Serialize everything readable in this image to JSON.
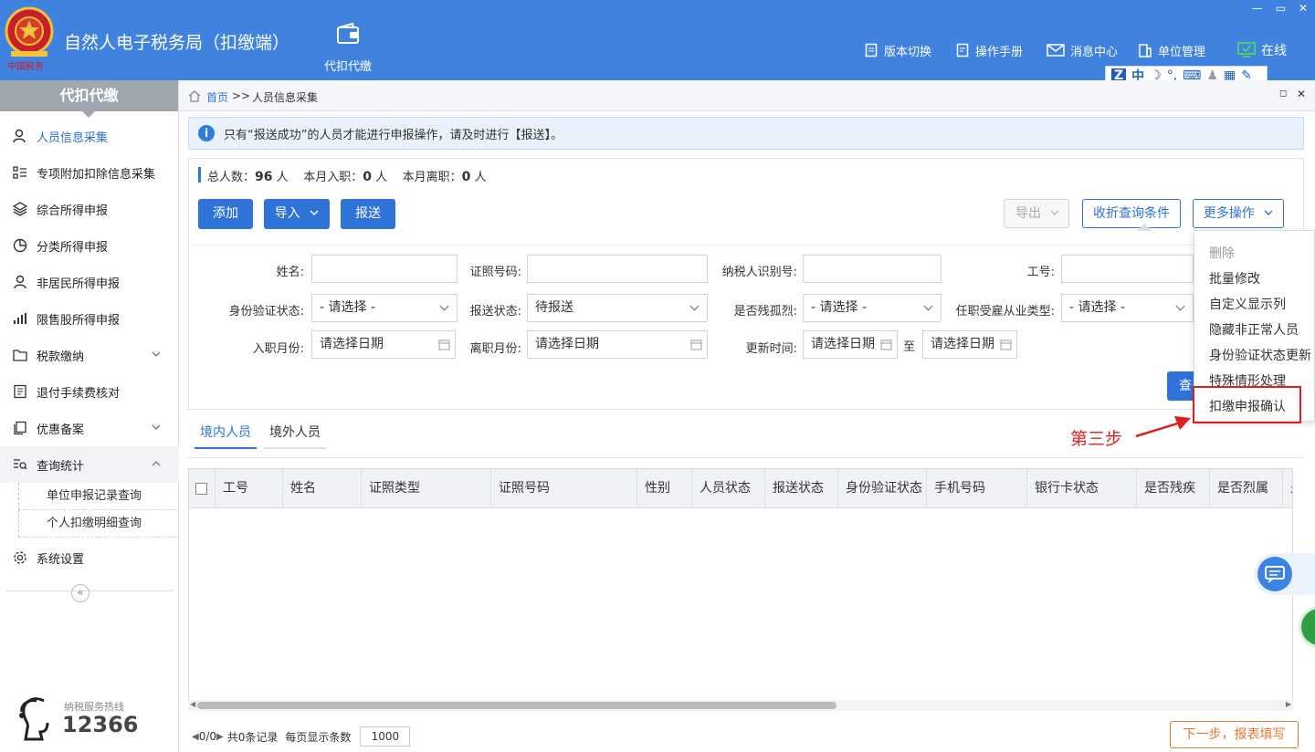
{
  "header": {
    "app_title": "自然人电子税务局（扣缴端）",
    "module_tab": "代扣代缴",
    "links": [
      "版本切换",
      "操作手册",
      "消息中心",
      "单位管理",
      "在线"
    ],
    "ime_label": "中",
    "color": "#3f82e0"
  },
  "sidebar": {
    "title": "代扣代缴",
    "items": [
      {
        "label": "人员信息采集",
        "icon": "user-icon"
      },
      {
        "label": "专项附加扣除信息采集",
        "icon": "list-icon"
      },
      {
        "label": "综合所得申报",
        "icon": "layers-icon"
      },
      {
        "label": "分类所得申报",
        "icon": "pie-icon"
      },
      {
        "label": "非居民所得申报",
        "icon": "person-icon"
      },
      {
        "label": "限售股所得申报",
        "icon": "bar-icon"
      },
      {
        "label": "税款缴纳",
        "icon": "folder-icon"
      },
      {
        "label": "退付手续费核对",
        "icon": "doc-icon"
      },
      {
        "label": "优惠备案",
        "icon": "copy-icon"
      },
      {
        "label": "查询统计",
        "icon": "search-list-icon"
      },
      {
        "label": "系统设置",
        "icon": "gear-icon"
      }
    ],
    "subitems": [
      "单位申报记录查询",
      "个人扣缴明细查询"
    ],
    "hotline_label": "纳税服务热线",
    "hotline_number": "12366",
    "collapse_glyph": "«"
  },
  "breadcrumb": {
    "home": "首页",
    "sep": ">>",
    "current": "人员信息采集"
  },
  "notice": {
    "icon": "i",
    "text": "只有“报送成功”的人员才能进行申报操作，请及时进行【报送】。"
  },
  "summary": {
    "total_label": "总人数：",
    "total": "96",
    "unit": "人",
    "join_label": "本月入职：",
    "join": "0",
    "leave_label": "本月离职：",
    "leave": "0"
  },
  "toolbar": {
    "add": "添加",
    "import": "导入",
    "submit": "报送",
    "export": "导出",
    "collapse_query": "收折查询条件",
    "more": "更多操作"
  },
  "filters": {
    "name": "姓名:",
    "id_no": "证照号码:",
    "taxpayer_id": "纳税人识别号:",
    "job_no": "工号:",
    "id_verify": "身份验证状态:",
    "id_verify_value": "- 请选择 -",
    "submit_status": "报送状态:",
    "submit_status_value": "待报送",
    "disabled": "是否残孤烈:",
    "disabled_value": "- 请选择 -",
    "employ_type": "任职受雇从业类型:",
    "employ_type_value": "- 请选择 -",
    "join_month": "入职月份:",
    "join_month_value": "请选择日期",
    "leave_month": "离职月份:",
    "leave_month_value": "请选择日期",
    "update_time": "更新时间:",
    "update_from": "请选择日期",
    "to": "至",
    "update_to": "请选择日期",
    "query_btn": "查"
  },
  "more_menu": [
    "删除",
    "批量修改",
    "自定义显示列",
    "隐藏非正常人员",
    "身份验证状态更新",
    "特殊情形处理",
    "扣缴申报确认"
  ],
  "annotation": {
    "step": "第三步",
    "color": "#e02020"
  },
  "tabs": [
    "境内人员",
    "境外人员"
  ],
  "table": {
    "columns": [
      "工号",
      "姓名",
      "证照类型",
      "证照号码",
      "性别",
      "人员状态",
      "报送状态",
      "身份验证状态",
      "手机号码",
      "银行卡状态",
      "是否残疾",
      "是否烈属",
      "是"
    ]
  },
  "pager": {
    "pages": "0/0",
    "records": "共0条记录",
    "per_page_label": "每页显示条数",
    "per_page": "1000"
  },
  "footer": {
    "next": "下一步，报表填写"
  }
}
